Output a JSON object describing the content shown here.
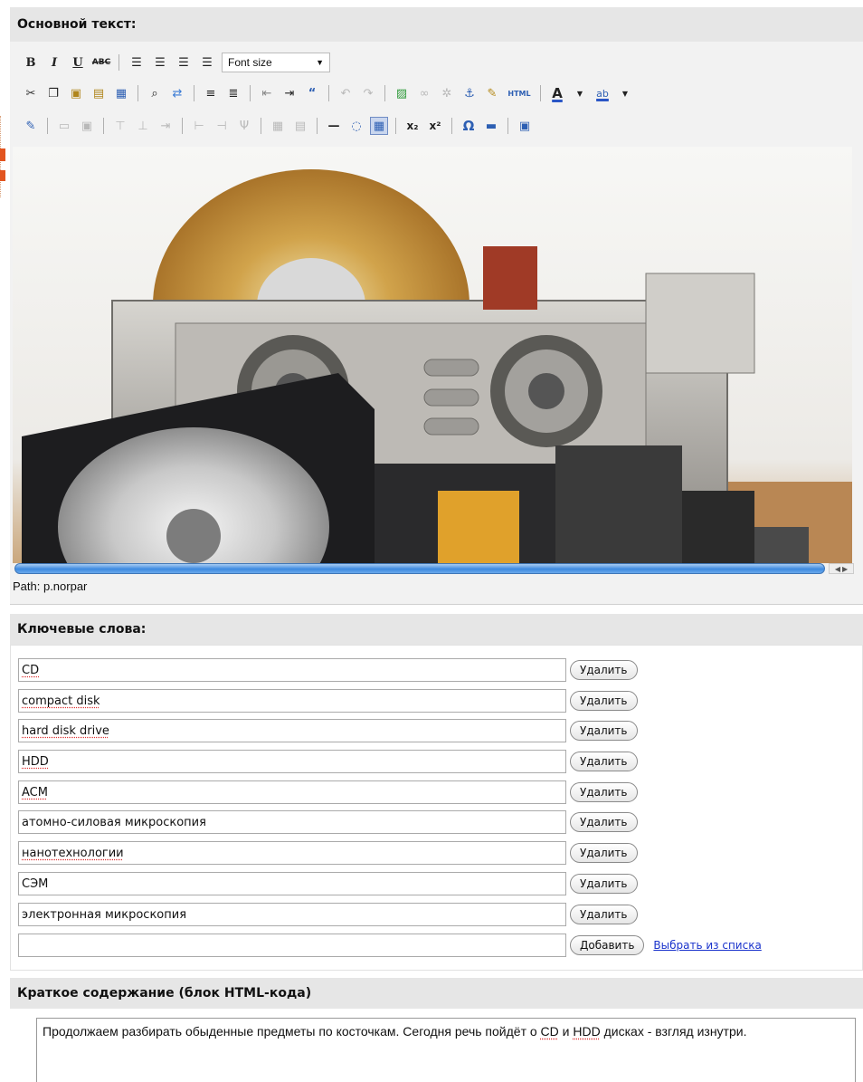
{
  "editor": {
    "section_title": "Основной текст:",
    "font_size_label": "Font size",
    "html_button_label": "HTML",
    "path_text": "Path: p.norpar"
  },
  "keywords": {
    "section_title": "Ключевые слова:",
    "items": [
      "CD",
      "compact disk",
      "hard disk drive",
      "HDD",
      "ACM",
      "атомно-силовая микроскопия",
      "нанотехнологии",
      "СЭМ",
      "электронная микроскопия"
    ],
    "delete_label": "Удалить",
    "add_label": "Добавить",
    "choose_link": "Выбрать из списка",
    "new_value": ""
  },
  "summary": {
    "section_title": "Краткое содержание (блок HTML-кода)",
    "text_part1": "Продолжаем разбирать обыденные предметы по косточкам. Сегодня речь пойдёт о ",
    "text_cd": "CD",
    "text_and": " и ",
    "text_hdd": "HDD",
    "text_part2": " дисках - взгляд изнутри."
  }
}
